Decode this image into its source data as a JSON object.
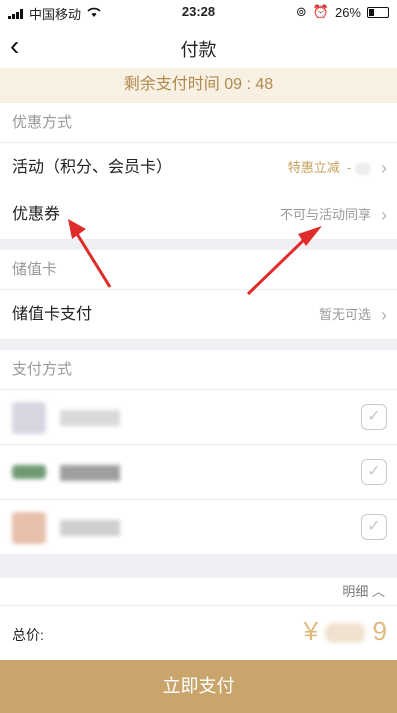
{
  "status_bar": {
    "carrier": "中国移动",
    "time": "23:28",
    "battery": "26%"
  },
  "navbar": {
    "back_icon": "chevron-left-icon",
    "title": "付款"
  },
  "timer": {
    "text": "剩余支付时间 09 : 48"
  },
  "discount": {
    "heading": "优惠方式",
    "activity": {
      "label": "活动（积分、会员卡）",
      "hint": "特惠立减",
      "hint_extra": "-"
    },
    "coupon": {
      "label": "优惠券",
      "hint": "不可与活动同享"
    }
  },
  "stored_card": {
    "heading": "储值卡",
    "row": {
      "label": "储值卡支付",
      "hint": "暂无可选"
    }
  },
  "payment": {
    "heading": "支付方式"
  },
  "summary": {
    "detail_label": "明细",
    "total_label": "总价:",
    "currency": "¥",
    "price_suffix": "9"
  },
  "action": {
    "pay_label": "立即支付"
  },
  "colors": {
    "accent": "#c9a56b",
    "timer_bg": "#f7f0e3",
    "price": "#e0b980",
    "arrow": "#e02b2b"
  }
}
